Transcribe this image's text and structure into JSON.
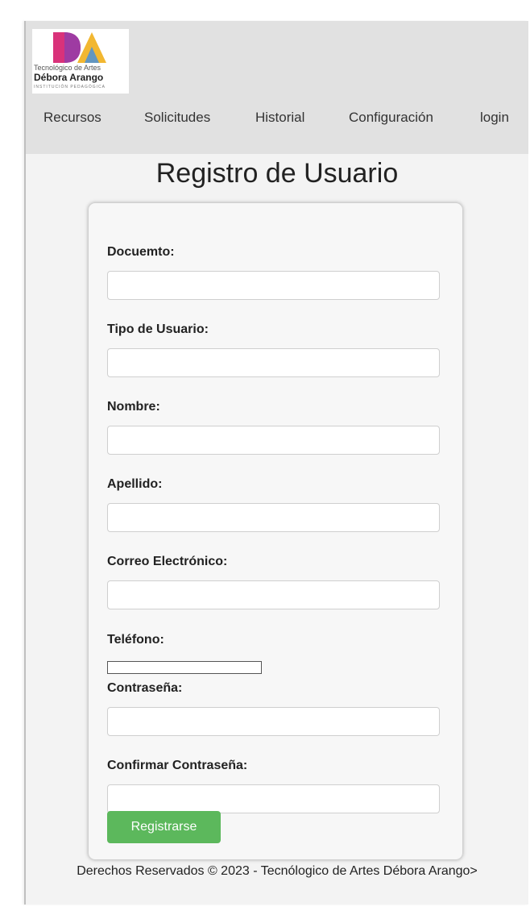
{
  "logo": {
    "line1": "Tecnológico de Artes",
    "line2": "Débora Arango",
    "line3": "INSTITUCIÓN PEDAGÓGICA",
    "colors": {
      "pink": "#d9327a",
      "purple": "#8a3fb0",
      "yellow": "#f2b731",
      "blue": "#4a90d9"
    }
  },
  "nav": {
    "items": [
      "Recursos",
      "Solicitudes",
      "Historial",
      "Configuración",
      "login"
    ]
  },
  "page": {
    "title": "Registro de Usuario"
  },
  "form": {
    "fields": [
      {
        "label": "Docuemto:",
        "value": ""
      },
      {
        "label": "Tipo de Usuario:",
        "value": ""
      },
      {
        "label": "Nombre:",
        "value": ""
      },
      {
        "label": "Apellido:",
        "value": ""
      },
      {
        "label": "Correo Electrónico:",
        "value": ""
      },
      {
        "label": "Teléfono:",
        "value": ""
      },
      {
        "label": "Contraseña:",
        "value": ""
      },
      {
        "label": "Confirmar Contraseña:",
        "value": ""
      }
    ],
    "submit_label": "Registrarse",
    "submit_color": "#5cb85c"
  },
  "footer": {
    "text": "Derechos Reservados © 2023 - Tecnólogico de Artes Débora Arango>"
  }
}
